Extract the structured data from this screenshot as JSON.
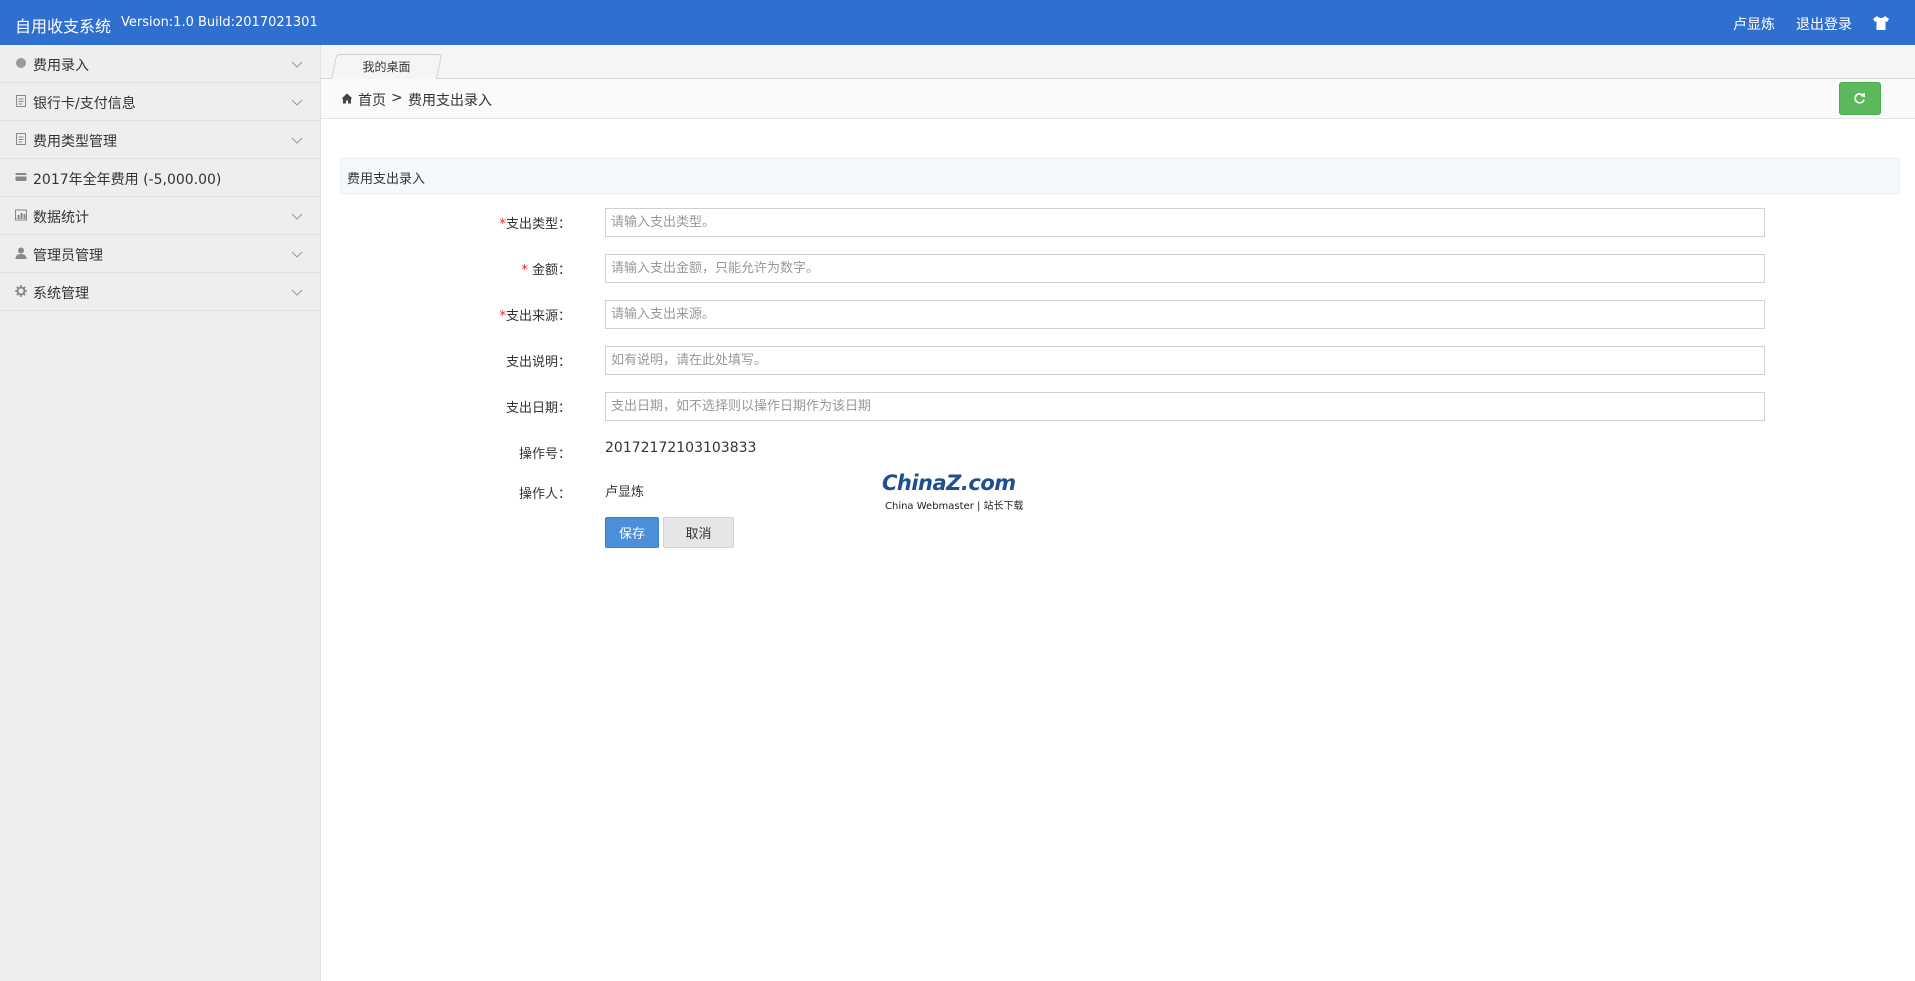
{
  "header": {
    "app_title": "自用收支系统",
    "version": "Version:1.0 Build:2017021301",
    "user": "卢显炼",
    "logout": "退出登录",
    "skin_icon": "shirt-icon",
    "bg_color": "#2f6fcf"
  },
  "sidebar": {
    "items": [
      {
        "label": "费用录入",
        "icon": "circle-icon",
        "has_submenu": true
      },
      {
        "label": "银行卡/支付信息",
        "icon": "document-icon",
        "has_submenu": true
      },
      {
        "label": "费用类型管理",
        "icon": "document-icon",
        "has_submenu": true
      },
      {
        "label": "2017年全年费用 (-5,000.00)",
        "icon": "card-icon",
        "has_submenu": false
      },
      {
        "label": "数据统计",
        "icon": "chart-icon",
        "has_submenu": true
      },
      {
        "label": "管理员管理",
        "icon": "user-icon",
        "has_submenu": true
      },
      {
        "label": "系统管理",
        "icon": "gear-icon",
        "has_submenu": true
      }
    ]
  },
  "tabs": [
    {
      "label": "我的桌面"
    }
  ],
  "breadcrumb": {
    "home": "首页",
    "separator": ">",
    "current": "费用支出录入"
  },
  "panel": {
    "title": "费用支出录入"
  },
  "form": {
    "required_mark": "*",
    "expense_type": {
      "label": "支出类型：",
      "placeholder": "请输入支出类型。",
      "value": ""
    },
    "amount": {
      "label": "金额：",
      "placeholder": "请输入支出金额，只能允许为数字。",
      "value": ""
    },
    "source": {
      "label": "支出来源：",
      "placeholder": "请输入支出来源。",
      "value": ""
    },
    "description": {
      "label": "支出说明：",
      "placeholder": "如有说明，请在此处填写。",
      "value": ""
    },
    "date": {
      "label": "支出日期：",
      "placeholder": "支出日期，如不选择则以操作日期作为该日期",
      "value": ""
    },
    "operation_no": {
      "label": "操作号：",
      "value": "20172172103103833"
    },
    "operator": {
      "label": "操作人：",
      "value": "卢显炼"
    },
    "save": "保存",
    "cancel": "取消"
  },
  "watermark": {
    "main": "ChinaZ.com",
    "sub": "China Webmaster | 站长下载"
  },
  "colors": {
    "accent": "#2f6fcf",
    "refresh": "#5cb85c",
    "save": "#4a8fd8"
  }
}
